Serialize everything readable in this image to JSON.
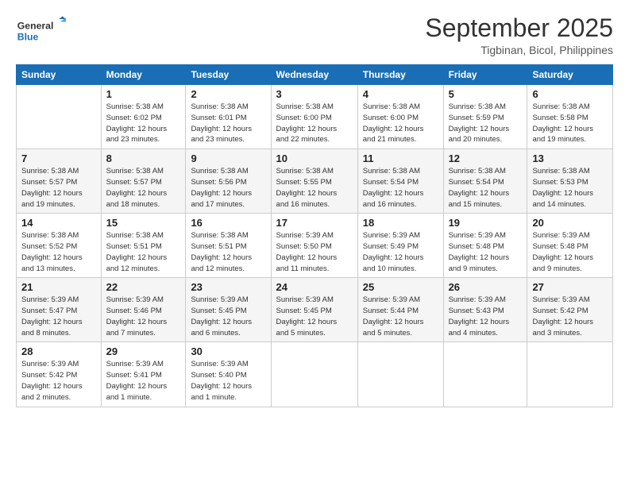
{
  "logo": {
    "line1": "General",
    "line2": "Blue"
  },
  "title": "September 2025",
  "location": "Tigbinan, Bicol, Philippines",
  "weekdays": [
    "Sunday",
    "Monday",
    "Tuesday",
    "Wednesday",
    "Thursday",
    "Friday",
    "Saturday"
  ],
  "weeks": [
    [
      {
        "day": "",
        "info": ""
      },
      {
        "day": "1",
        "info": "Sunrise: 5:38 AM\nSunset: 6:02 PM\nDaylight: 12 hours\nand 23 minutes."
      },
      {
        "day": "2",
        "info": "Sunrise: 5:38 AM\nSunset: 6:01 PM\nDaylight: 12 hours\nand 23 minutes."
      },
      {
        "day": "3",
        "info": "Sunrise: 5:38 AM\nSunset: 6:00 PM\nDaylight: 12 hours\nand 22 minutes."
      },
      {
        "day": "4",
        "info": "Sunrise: 5:38 AM\nSunset: 6:00 PM\nDaylight: 12 hours\nand 21 minutes."
      },
      {
        "day": "5",
        "info": "Sunrise: 5:38 AM\nSunset: 5:59 PM\nDaylight: 12 hours\nand 20 minutes."
      },
      {
        "day": "6",
        "info": "Sunrise: 5:38 AM\nSunset: 5:58 PM\nDaylight: 12 hours\nand 19 minutes."
      }
    ],
    [
      {
        "day": "7",
        "info": "Sunrise: 5:38 AM\nSunset: 5:57 PM\nDaylight: 12 hours\nand 19 minutes."
      },
      {
        "day": "8",
        "info": "Sunrise: 5:38 AM\nSunset: 5:57 PM\nDaylight: 12 hours\nand 18 minutes."
      },
      {
        "day": "9",
        "info": "Sunrise: 5:38 AM\nSunset: 5:56 PM\nDaylight: 12 hours\nand 17 minutes."
      },
      {
        "day": "10",
        "info": "Sunrise: 5:38 AM\nSunset: 5:55 PM\nDaylight: 12 hours\nand 16 minutes."
      },
      {
        "day": "11",
        "info": "Sunrise: 5:38 AM\nSunset: 5:54 PM\nDaylight: 12 hours\nand 16 minutes."
      },
      {
        "day": "12",
        "info": "Sunrise: 5:38 AM\nSunset: 5:54 PM\nDaylight: 12 hours\nand 15 minutes."
      },
      {
        "day": "13",
        "info": "Sunrise: 5:38 AM\nSunset: 5:53 PM\nDaylight: 12 hours\nand 14 minutes."
      }
    ],
    [
      {
        "day": "14",
        "info": "Sunrise: 5:38 AM\nSunset: 5:52 PM\nDaylight: 12 hours\nand 13 minutes."
      },
      {
        "day": "15",
        "info": "Sunrise: 5:38 AM\nSunset: 5:51 PM\nDaylight: 12 hours\nand 12 minutes."
      },
      {
        "day": "16",
        "info": "Sunrise: 5:38 AM\nSunset: 5:51 PM\nDaylight: 12 hours\nand 12 minutes."
      },
      {
        "day": "17",
        "info": "Sunrise: 5:39 AM\nSunset: 5:50 PM\nDaylight: 12 hours\nand 11 minutes."
      },
      {
        "day": "18",
        "info": "Sunrise: 5:39 AM\nSunset: 5:49 PM\nDaylight: 12 hours\nand 10 minutes."
      },
      {
        "day": "19",
        "info": "Sunrise: 5:39 AM\nSunset: 5:48 PM\nDaylight: 12 hours\nand 9 minutes."
      },
      {
        "day": "20",
        "info": "Sunrise: 5:39 AM\nSunset: 5:48 PM\nDaylight: 12 hours\nand 9 minutes."
      }
    ],
    [
      {
        "day": "21",
        "info": "Sunrise: 5:39 AM\nSunset: 5:47 PM\nDaylight: 12 hours\nand 8 minutes."
      },
      {
        "day": "22",
        "info": "Sunrise: 5:39 AM\nSunset: 5:46 PM\nDaylight: 12 hours\nand 7 minutes."
      },
      {
        "day": "23",
        "info": "Sunrise: 5:39 AM\nSunset: 5:45 PM\nDaylight: 12 hours\nand 6 minutes."
      },
      {
        "day": "24",
        "info": "Sunrise: 5:39 AM\nSunset: 5:45 PM\nDaylight: 12 hours\nand 5 minutes."
      },
      {
        "day": "25",
        "info": "Sunrise: 5:39 AM\nSunset: 5:44 PM\nDaylight: 12 hours\nand 5 minutes."
      },
      {
        "day": "26",
        "info": "Sunrise: 5:39 AM\nSunset: 5:43 PM\nDaylight: 12 hours\nand 4 minutes."
      },
      {
        "day": "27",
        "info": "Sunrise: 5:39 AM\nSunset: 5:42 PM\nDaylight: 12 hours\nand 3 minutes."
      }
    ],
    [
      {
        "day": "28",
        "info": "Sunrise: 5:39 AM\nSunset: 5:42 PM\nDaylight: 12 hours\nand 2 minutes."
      },
      {
        "day": "29",
        "info": "Sunrise: 5:39 AM\nSunset: 5:41 PM\nDaylight: 12 hours\nand 1 minute."
      },
      {
        "day": "30",
        "info": "Sunrise: 5:39 AM\nSunset: 5:40 PM\nDaylight: 12 hours\nand 1 minute."
      },
      {
        "day": "",
        "info": ""
      },
      {
        "day": "",
        "info": ""
      },
      {
        "day": "",
        "info": ""
      },
      {
        "day": "",
        "info": ""
      }
    ]
  ]
}
